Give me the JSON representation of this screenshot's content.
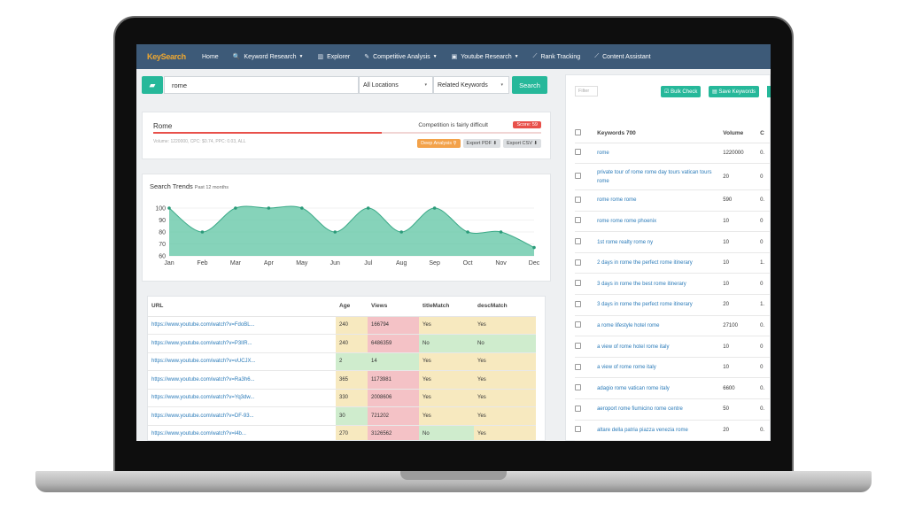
{
  "navbar": {
    "logo": "KeySearch",
    "items": [
      {
        "label": "Home",
        "icon": ""
      },
      {
        "label": "Keyword Research",
        "icon": "search-icon",
        "glyph": "🔍",
        "dropdown": true
      },
      {
        "label": "Explorer",
        "icon": "bar-chart-icon",
        "glyph": "▥",
        "dropdown": false
      },
      {
        "label": "Competitive Analysis",
        "icon": "wrench-icon",
        "glyph": "✎",
        "dropdown": true
      },
      {
        "label": "Youtube Research",
        "icon": "video-icon",
        "glyph": "▣",
        "dropdown": true
      },
      {
        "label": "Rank Tracking",
        "icon": "line-chart-icon",
        "glyph": "⟋",
        "dropdown": false
      },
      {
        "label": "Content Assistant",
        "icon": "line-chart-icon",
        "glyph": "⟋",
        "dropdown": false
      }
    ]
  },
  "search": {
    "query": "rome",
    "location": "All Locations",
    "mode": "Related Keywords",
    "button": "Search"
  },
  "keyword_card": {
    "title": "Rome",
    "competition": "Competition is fairly difficult",
    "score": "Score: 59",
    "score_value": 59,
    "meta": "Volume: 1220000, CPC: $0.74, PPC: 0.03, ALL",
    "deep_analysis": "Deep Analysis",
    "export_pdf": "Export PDF",
    "export_csv": "Export CSV"
  },
  "trends": {
    "title": "Search Trends",
    "subtitle": "Past 12 months"
  },
  "chart_data": {
    "type": "area",
    "title": "Search Trends",
    "categories": [
      "Jan",
      "Feb",
      "Mar",
      "Apr",
      "May",
      "Jun",
      "Jul",
      "Aug",
      "Sep",
      "Oct",
      "Nov",
      "Dec"
    ],
    "values": [
      100,
      80,
      100,
      100,
      100,
      80,
      100,
      80,
      100,
      80,
      80,
      67
    ],
    "yticks": [
      60,
      70,
      80,
      90,
      100
    ],
    "ylim": [
      60,
      100
    ],
    "color": "#5ec4a3",
    "grid": true
  },
  "url_table": {
    "headers": [
      "URL",
      "Age",
      "Views",
      "titleMatch",
      "descMatch"
    ],
    "rows": [
      {
        "url": "https://www.youtube.com/watch?v=FdoBL...",
        "age": "240",
        "views": "166794",
        "title": "Yes",
        "desc": "Yes",
        "age_c": "yellow",
        "views_c": "red",
        "title_c": "yellow",
        "desc_c": "yellow"
      },
      {
        "url": "https://www.youtube.com/watch?v=P3lIR...",
        "age": "240",
        "views": "6486359",
        "title": "No",
        "desc": "No",
        "age_c": "yellow",
        "views_c": "red",
        "title_c": "green",
        "desc_c": "green"
      },
      {
        "url": "https://www.youtube.com/watch?v=vUCJX...",
        "age": "2",
        "views": "14",
        "title": "Yes",
        "desc": "Yes",
        "age_c": "green",
        "views_c": "green",
        "title_c": "yellow",
        "desc_c": "yellow"
      },
      {
        "url": "https://www.youtube.com/watch?v=Ra3h6...",
        "age": "365",
        "views": "1173981",
        "title": "Yes",
        "desc": "Yes",
        "age_c": "yellow",
        "views_c": "red",
        "title_c": "yellow",
        "desc_c": "yellow"
      },
      {
        "url": "https://www.youtube.com/watch?v=Yq3dw...",
        "age": "330",
        "views": "2008606",
        "title": "Yes",
        "desc": "Yes",
        "age_c": "yellow",
        "views_c": "red",
        "title_c": "yellow",
        "desc_c": "yellow"
      },
      {
        "url": "https://www.youtube.com/watch?v=DF-93...",
        "age": "30",
        "views": "721202",
        "title": "Yes",
        "desc": "Yes",
        "age_c": "green",
        "views_c": "red",
        "title_c": "yellow",
        "desc_c": "yellow"
      },
      {
        "url": "https://www.youtube.com/watch?v=l4b...",
        "age": "270",
        "views": "3126562",
        "title": "No",
        "desc": "Yes",
        "age_c": "yellow",
        "views_c": "red",
        "title_c": "green",
        "desc_c": "yellow"
      }
    ]
  },
  "right_panel": {
    "filter_placeholder": "Filter",
    "bulk_check": "Bulk Check",
    "save_keywords": "Save Keywords",
    "headers": {
      "keywords": "Keywords 700",
      "volume": "Volume",
      "cpc": "C"
    },
    "rows": [
      {
        "kw": "rome",
        "vol": "1220000",
        "c": "0."
      },
      {
        "kw": "private tour of rome rome day tours vatican tours rome",
        "vol": "20",
        "c": "0"
      },
      {
        "kw": "rome rome rome",
        "vol": "590",
        "c": "0."
      },
      {
        "kw": "rome rome rome phoenix",
        "vol": "10",
        "c": "0"
      },
      {
        "kw": "1st rome realty rome ny",
        "vol": "10",
        "c": "0"
      },
      {
        "kw": "2 days in rome the perfect rome itinerary",
        "vol": "10",
        "c": "1."
      },
      {
        "kw": "3 days in rome the best rome itinerary",
        "vol": "10",
        "c": "0"
      },
      {
        "kw": "3 days in rome the perfect rome itinerary",
        "vol": "20",
        "c": "1."
      },
      {
        "kw": "a rome lifestyle hotel rome",
        "vol": "27100",
        "c": "0."
      },
      {
        "kw": "a view of rome hotel rome italy",
        "vol": "10",
        "c": "0"
      },
      {
        "kw": "a view of rome rome italy",
        "vol": "10",
        "c": "0"
      },
      {
        "kw": "adagio rome vatican rome italy",
        "vol": "6600",
        "c": "0."
      },
      {
        "kw": "aeroport rome fiumicino rome centre",
        "vol": "50",
        "c": "0."
      },
      {
        "kw": "altare della patria piazza venezia rome",
        "vol": "20",
        "c": "0."
      }
    ]
  }
}
